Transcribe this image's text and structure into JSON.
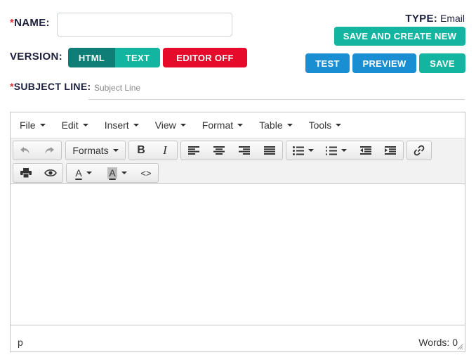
{
  "form": {
    "name_label": "NAME:",
    "name_value": "",
    "required_mark": "*",
    "version_label": "VERSION:",
    "subject_label": "SUBJECT LINE:",
    "subject_placeholder": "Subject Line",
    "type_label": "TYPE:",
    "type_value": "Email"
  },
  "version_toggle": {
    "html": "HTML",
    "text": "TEXT",
    "active": "HTML"
  },
  "buttons": {
    "editor_off": "EDITOR OFF",
    "save_and_create_new": "SAVE AND CREATE NEW",
    "test": "TEST",
    "preview": "PREVIEW",
    "save": "SAVE"
  },
  "editor": {
    "menu": [
      "File",
      "Edit",
      "Insert",
      "View",
      "Format",
      "Table",
      "Tools"
    ],
    "formats_label": "Formats",
    "bold_glyph": "B",
    "italic_glyph": "I",
    "text_color_glyph": "A",
    "bg_color_glyph": "A",
    "code_glyph": "<>",
    "status_path": "p",
    "word_count": "Words: 0"
  },
  "colors": {
    "teal": "#13b5a0",
    "teal_dark": "#0e7e77",
    "blue": "#1a8ed2",
    "red": "#e60b2a",
    "label": "#1b1f3b",
    "required": "#e0303a"
  },
  "icons": [
    "undo-icon",
    "redo-icon",
    "align-left-icon",
    "align-center-icon",
    "align-right-icon",
    "align-justify-icon",
    "bullet-list-icon",
    "numbered-list-icon",
    "outdent-icon",
    "indent-icon",
    "link-icon",
    "print-icon",
    "preview-eye-icon",
    "source-code-icon"
  ]
}
